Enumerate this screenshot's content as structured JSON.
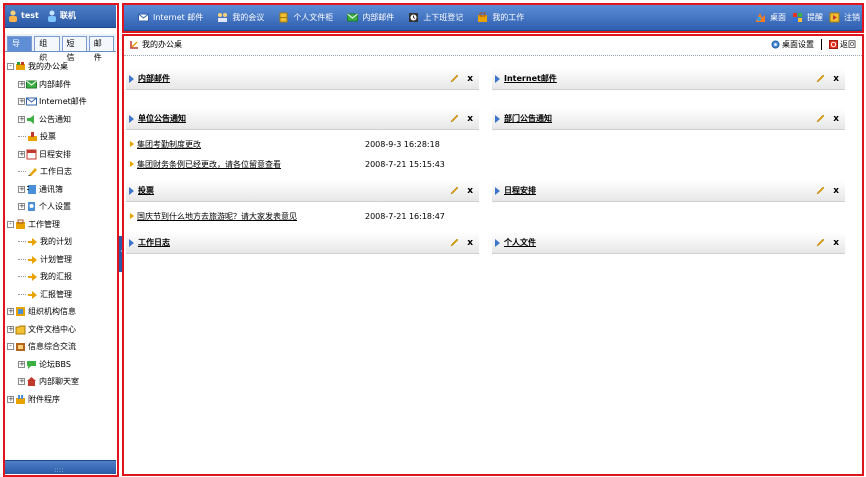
{
  "left": {
    "user": "test",
    "status": "联机",
    "tabs": [
      "导航",
      "组织",
      "短信",
      "邮件"
    ],
    "tree": [
      {
        "label": "我的办公桌",
        "level": 0,
        "exp": "-",
        "icon": "desk-icon"
      },
      {
        "label": "内部邮件",
        "level": 1,
        "exp": "+",
        "icon": "mail-icon"
      },
      {
        "label": "Internet邮件",
        "level": 1,
        "exp": "+",
        "icon": "internet-mail-icon"
      },
      {
        "label": "公告通知",
        "level": 1,
        "exp": "+",
        "icon": "speaker-icon"
      },
      {
        "label": "投票",
        "level": 1,
        "exp": "",
        "icon": "vote-icon"
      },
      {
        "label": "日程安排",
        "level": 1,
        "exp": "+",
        "icon": "calendar-icon"
      },
      {
        "label": "工作日志",
        "level": 1,
        "exp": "",
        "icon": "log-icon"
      },
      {
        "label": "通讯簿",
        "level": 1,
        "exp": "+",
        "icon": "addressbook-icon"
      },
      {
        "label": "个人设置",
        "level": 1,
        "exp": "+",
        "icon": "settings-icon"
      },
      {
        "label": "工作管理",
        "level": 0,
        "exp": "-",
        "icon": "work-icon"
      },
      {
        "label": "我的计划",
        "level": 1,
        "exp": "",
        "icon": "plan-icon"
      },
      {
        "label": "计划管理",
        "level": 1,
        "exp": "",
        "icon": "plan-icon"
      },
      {
        "label": "我的汇报",
        "level": 1,
        "exp": "",
        "icon": "plan-icon"
      },
      {
        "label": "汇报管理",
        "level": 1,
        "exp": "",
        "icon": "plan-icon"
      },
      {
        "label": "组织机构信息",
        "level": 0,
        "exp": "+",
        "icon": "org-icon"
      },
      {
        "label": "文件文档中心",
        "level": 0,
        "exp": "+",
        "icon": "folder-icon"
      },
      {
        "label": "信息综合交流",
        "level": 0,
        "exp": "-",
        "icon": "info-icon"
      },
      {
        "label": "论坛BBS",
        "level": 1,
        "exp": "+",
        "icon": "forum-icon"
      },
      {
        "label": "内部聊天室",
        "level": 1,
        "exp": "+",
        "icon": "chat-icon"
      },
      {
        "label": "附件程序",
        "level": 0,
        "exp": "+",
        "icon": "plugin-icon"
      }
    ]
  },
  "topbar": {
    "items": [
      {
        "label": "Internet 邮件",
        "icon": "internet-mail-icon"
      },
      {
        "label": "我的会议",
        "icon": "meeting-icon"
      },
      {
        "label": "个人文件柜",
        "icon": "cabinet-icon"
      },
      {
        "label": "内部邮件",
        "icon": "mail-icon"
      },
      {
        "label": "上下班登记",
        "icon": "clock-icon"
      },
      {
        "label": "我的工作",
        "icon": "work-icon"
      }
    ],
    "right": [
      {
        "label": "桌面",
        "icon": "desktop-icon"
      },
      {
        "label": "提醒",
        "icon": "remind-icon"
      },
      {
        "label": "注销",
        "icon": "logout-icon"
      }
    ]
  },
  "main": {
    "breadcrumb": "我的办公桌",
    "desktop_settings": "桌面设置",
    "back": "返回",
    "left_panels": [
      {
        "title": "内部邮件",
        "rows": []
      },
      {
        "title": "单位公告通知",
        "rows": [
          {
            "text": "集团考勤制度更改",
            "date": "2008-9-3 16:28:18"
          },
          {
            "text": "集团财务条例已经更改，请各位留意查看",
            "date": "2008-7-21 15:15:43"
          }
        ]
      },
      {
        "title": "投票",
        "rows": [
          {
            "text": "国庆节到什么地方去旅游呢？请大家发表意见",
            "date": "2008-7-21 16:18:47"
          }
        ]
      },
      {
        "title": "工作日志",
        "rows": []
      }
    ],
    "right_panels": [
      {
        "title": "Internet邮件"
      },
      {
        "title": "部门公告通知"
      },
      {
        "title": "日程安排"
      },
      {
        "title": "个人文件"
      }
    ]
  },
  "colors": {
    "topbar": "#3f70c0",
    "frame": "#e0141c",
    "panel_arrow": "#3e75c8",
    "bullet": "#e8a300"
  }
}
